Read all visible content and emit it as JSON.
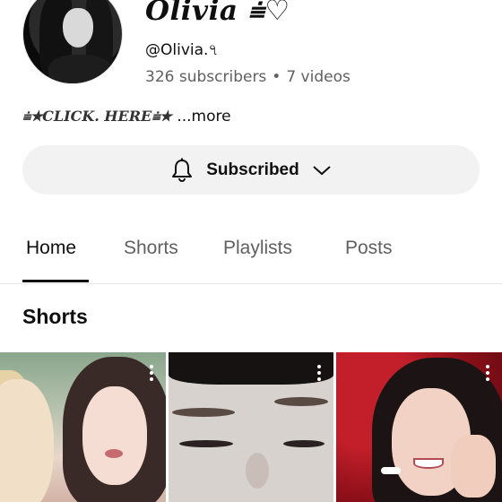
{
  "channel": {
    "name": "Olivia ⩧♡",
    "handle": "@Olivia.৭",
    "subscribers": "326 subscribers",
    "separator": "•",
    "videos": "7 videos"
  },
  "description": {
    "link_text": "⩧★CLICK. HERE⩧★",
    "more_label": "...more"
  },
  "subscribe_button": {
    "label": "Subscribed",
    "bell_icon": "bell-icon",
    "chevron_icon": "chevron-down-icon"
  },
  "tabs": [
    {
      "label": "Home",
      "active": true
    },
    {
      "label": "Shorts",
      "active": false
    },
    {
      "label": "Playlists",
      "active": false
    },
    {
      "label": "Posts",
      "active": false
    }
  ],
  "shorts_section": {
    "title": "Shorts"
  },
  "colors": {
    "text_primary": "#0f0f0f",
    "text_secondary": "#606060",
    "button_bg": "#f2f2f2",
    "divider": "#e5e5e5"
  }
}
